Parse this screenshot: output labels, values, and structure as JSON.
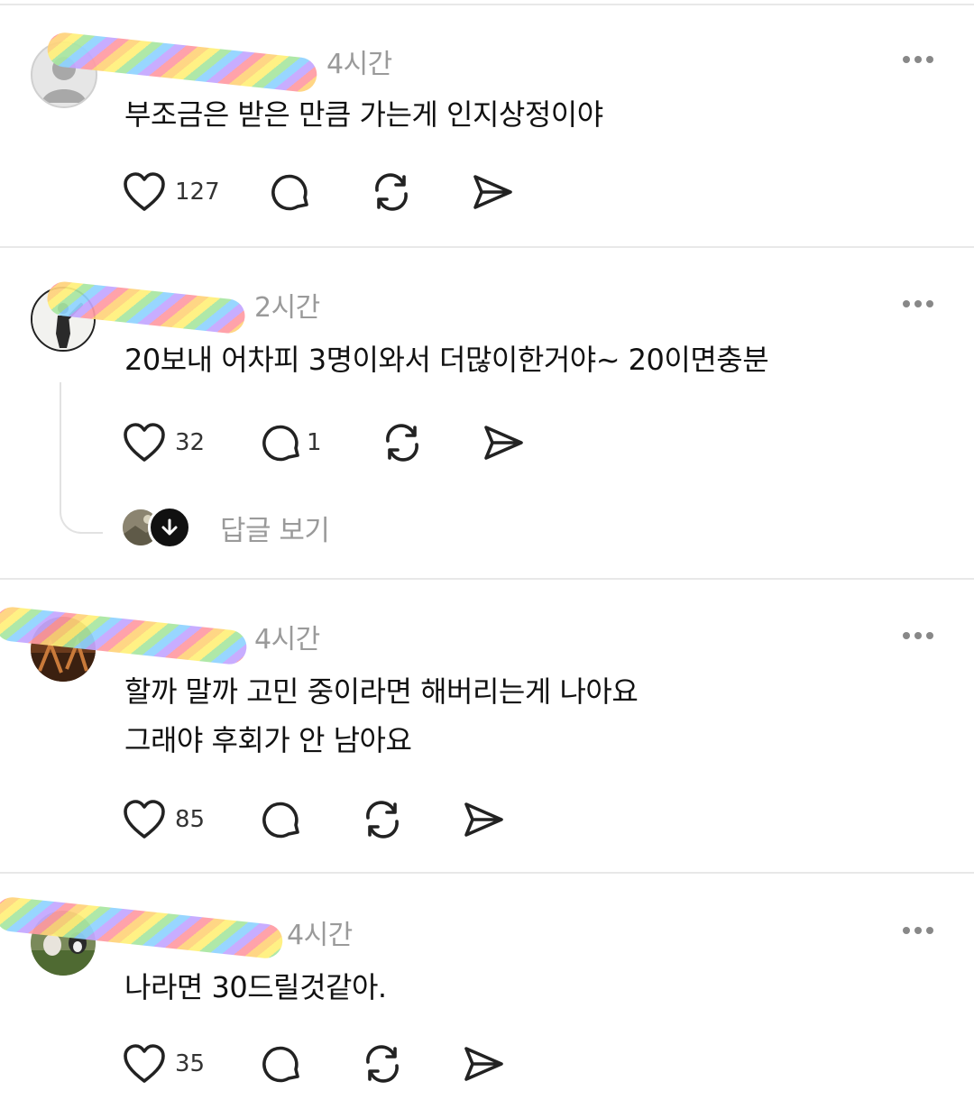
{
  "posts": [
    {
      "time": "4시간",
      "text_lines": [
        "부조금은 받은 만큼 가는게 인지상정이야"
      ],
      "likes": "127",
      "replies": ""
    },
    {
      "time": "2시간",
      "text_lines": [
        "20보내 어차피 3명이와서 더많이한거야~  20이면충분"
      ],
      "likes": "32",
      "replies": "1",
      "view_replies_label": "답글 보기"
    },
    {
      "time": "4시간",
      "text_lines": [
        "할까 말까 고민 중이라면 해버리는게 나아요",
        "그래야 후회가 안 남아요"
      ],
      "likes": "85",
      "replies": ""
    },
    {
      "time": "4시간",
      "text_lines": [
        "나라면 30드릴것같아."
      ],
      "likes": "35",
      "replies": ""
    }
  ],
  "icons": {
    "like": "heart-icon",
    "reply": "comment-icon",
    "repost": "repost-icon",
    "share": "send-icon",
    "more": "more-icon",
    "view_replies_badge": "arrow-down-icon"
  },
  "colors": {
    "text": "#111111",
    "muted": "#9a9a9a",
    "divider": "#e8e8e8"
  }
}
